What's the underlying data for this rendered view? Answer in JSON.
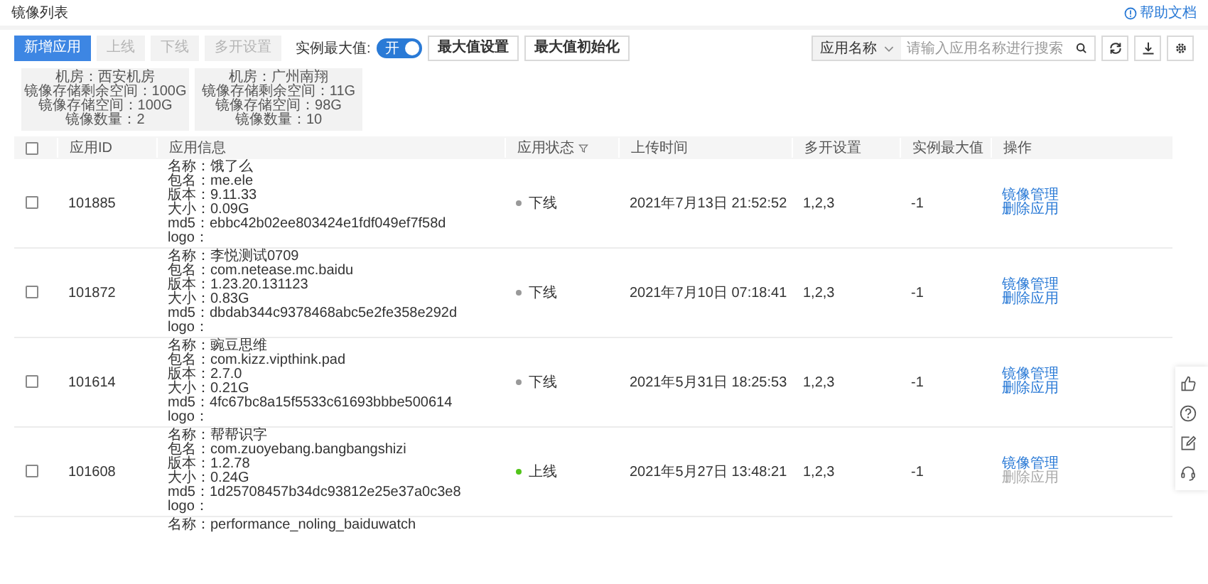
{
  "page": {
    "title": "镜像列表",
    "help_link": "帮助文档"
  },
  "toolbar": {
    "buttons": [
      {
        "label": "新增应用",
        "kind": "primary",
        "disabled": false
      },
      {
        "label": "上线",
        "kind": "default",
        "disabled": true
      },
      {
        "label": "下线",
        "kind": "default",
        "disabled": true
      },
      {
        "label": "多开设置",
        "kind": "default",
        "disabled": true
      }
    ],
    "max_label": "实例最大值:",
    "max_switch": {
      "label": "开",
      "on": true
    },
    "max_buttons": [
      "最大值设置",
      "最大值初始化"
    ],
    "search": {
      "field_select": "应用名称",
      "placeholder": "请输入应用名称进行搜索"
    }
  },
  "stats": [
    {
      "lines": [
        "机房：西安机房",
        "镜像存储剩余空间：100G",
        "镜像存储空间：100G",
        "镜像数量：2"
      ]
    },
    {
      "lines": [
        "机房：广州南翔",
        "镜像存储剩余空间：11G",
        "镜像存储空间：98G",
        "镜像数量：10"
      ]
    }
  ],
  "table": {
    "header_checked": false,
    "columns": [
      {
        "label": "应用ID",
        "filter": false
      },
      {
        "label": "应用信息",
        "filter": false
      },
      {
        "label": "应用状态",
        "filter": true
      },
      {
        "label": "上传时间",
        "filter": false
      },
      {
        "label": "多开设置",
        "filter": false
      },
      {
        "label": "实例最大值",
        "filter": false
      },
      {
        "label": "操作",
        "filter": false
      }
    ],
    "rows": [
      {
        "checked": false,
        "id": "101885",
        "info": [
          "名称：饿了么",
          "包名：me.ele",
          "版本：9.11.33",
          "大小：0.09G",
          "md5：ebbc42b02ee803424e1fdf049ef7f58d",
          "logo："
        ],
        "status": "下线",
        "online": false,
        "uploaded": "2021年7月13日 21:52:52",
        "multi": "1,2,3",
        "max": "-1",
        "actions": [
          {
            "label": "镜像管理",
            "disabled": false
          },
          {
            "label": "删除应用",
            "disabled": false
          }
        ]
      },
      {
        "checked": false,
        "id": "101872",
        "info": [
          "名称：李悦测试0709",
          "包名：com.netease.mc.baidu",
          "版本：1.23.20.131123",
          "大小：0.83G",
          "md5：dbdab344c9378468abc5e2fe358e292d",
          "logo："
        ],
        "status": "下线",
        "online": false,
        "uploaded": "2021年7月10日 07:18:41",
        "multi": "1,2,3",
        "max": "-1",
        "actions": [
          {
            "label": "镜像管理",
            "disabled": false
          },
          {
            "label": "删除应用",
            "disabled": false
          }
        ]
      },
      {
        "checked": false,
        "id": "101614",
        "info": [
          "名称：豌豆思维",
          "包名：com.kizz.vipthink.pad",
          "版本：2.7.0",
          "大小：0.21G",
          "md5：4fc67bc8a15f5533c61693bbbe500614",
          "logo："
        ],
        "status": "下线",
        "online": false,
        "uploaded": "2021年5月31日 18:25:53",
        "multi": "1,2,3",
        "max": "-1",
        "actions": [
          {
            "label": "镜像管理",
            "disabled": false
          },
          {
            "label": "删除应用",
            "disabled": false
          }
        ]
      },
      {
        "checked": false,
        "id": "101608",
        "info": [
          "名称：帮帮识字",
          "包名：com.zuoyebang.bangbangshizi",
          "版本：1.2.78",
          "大小：0.24G",
          "md5：1d25708457b34dc93812e25e37a0c3e8",
          "logo："
        ],
        "status": "上线",
        "online": true,
        "uploaded": "2021年5月27日 13:48:21",
        "multi": "1,2,3",
        "max": "-1",
        "actions": [
          {
            "label": "镜像管理",
            "disabled": false
          },
          {
            "label": "删除应用",
            "disabled": true
          }
        ]
      },
      {
        "info": [
          "名称：performance_noling_baiduwatch"
        ]
      }
    ]
  }
}
